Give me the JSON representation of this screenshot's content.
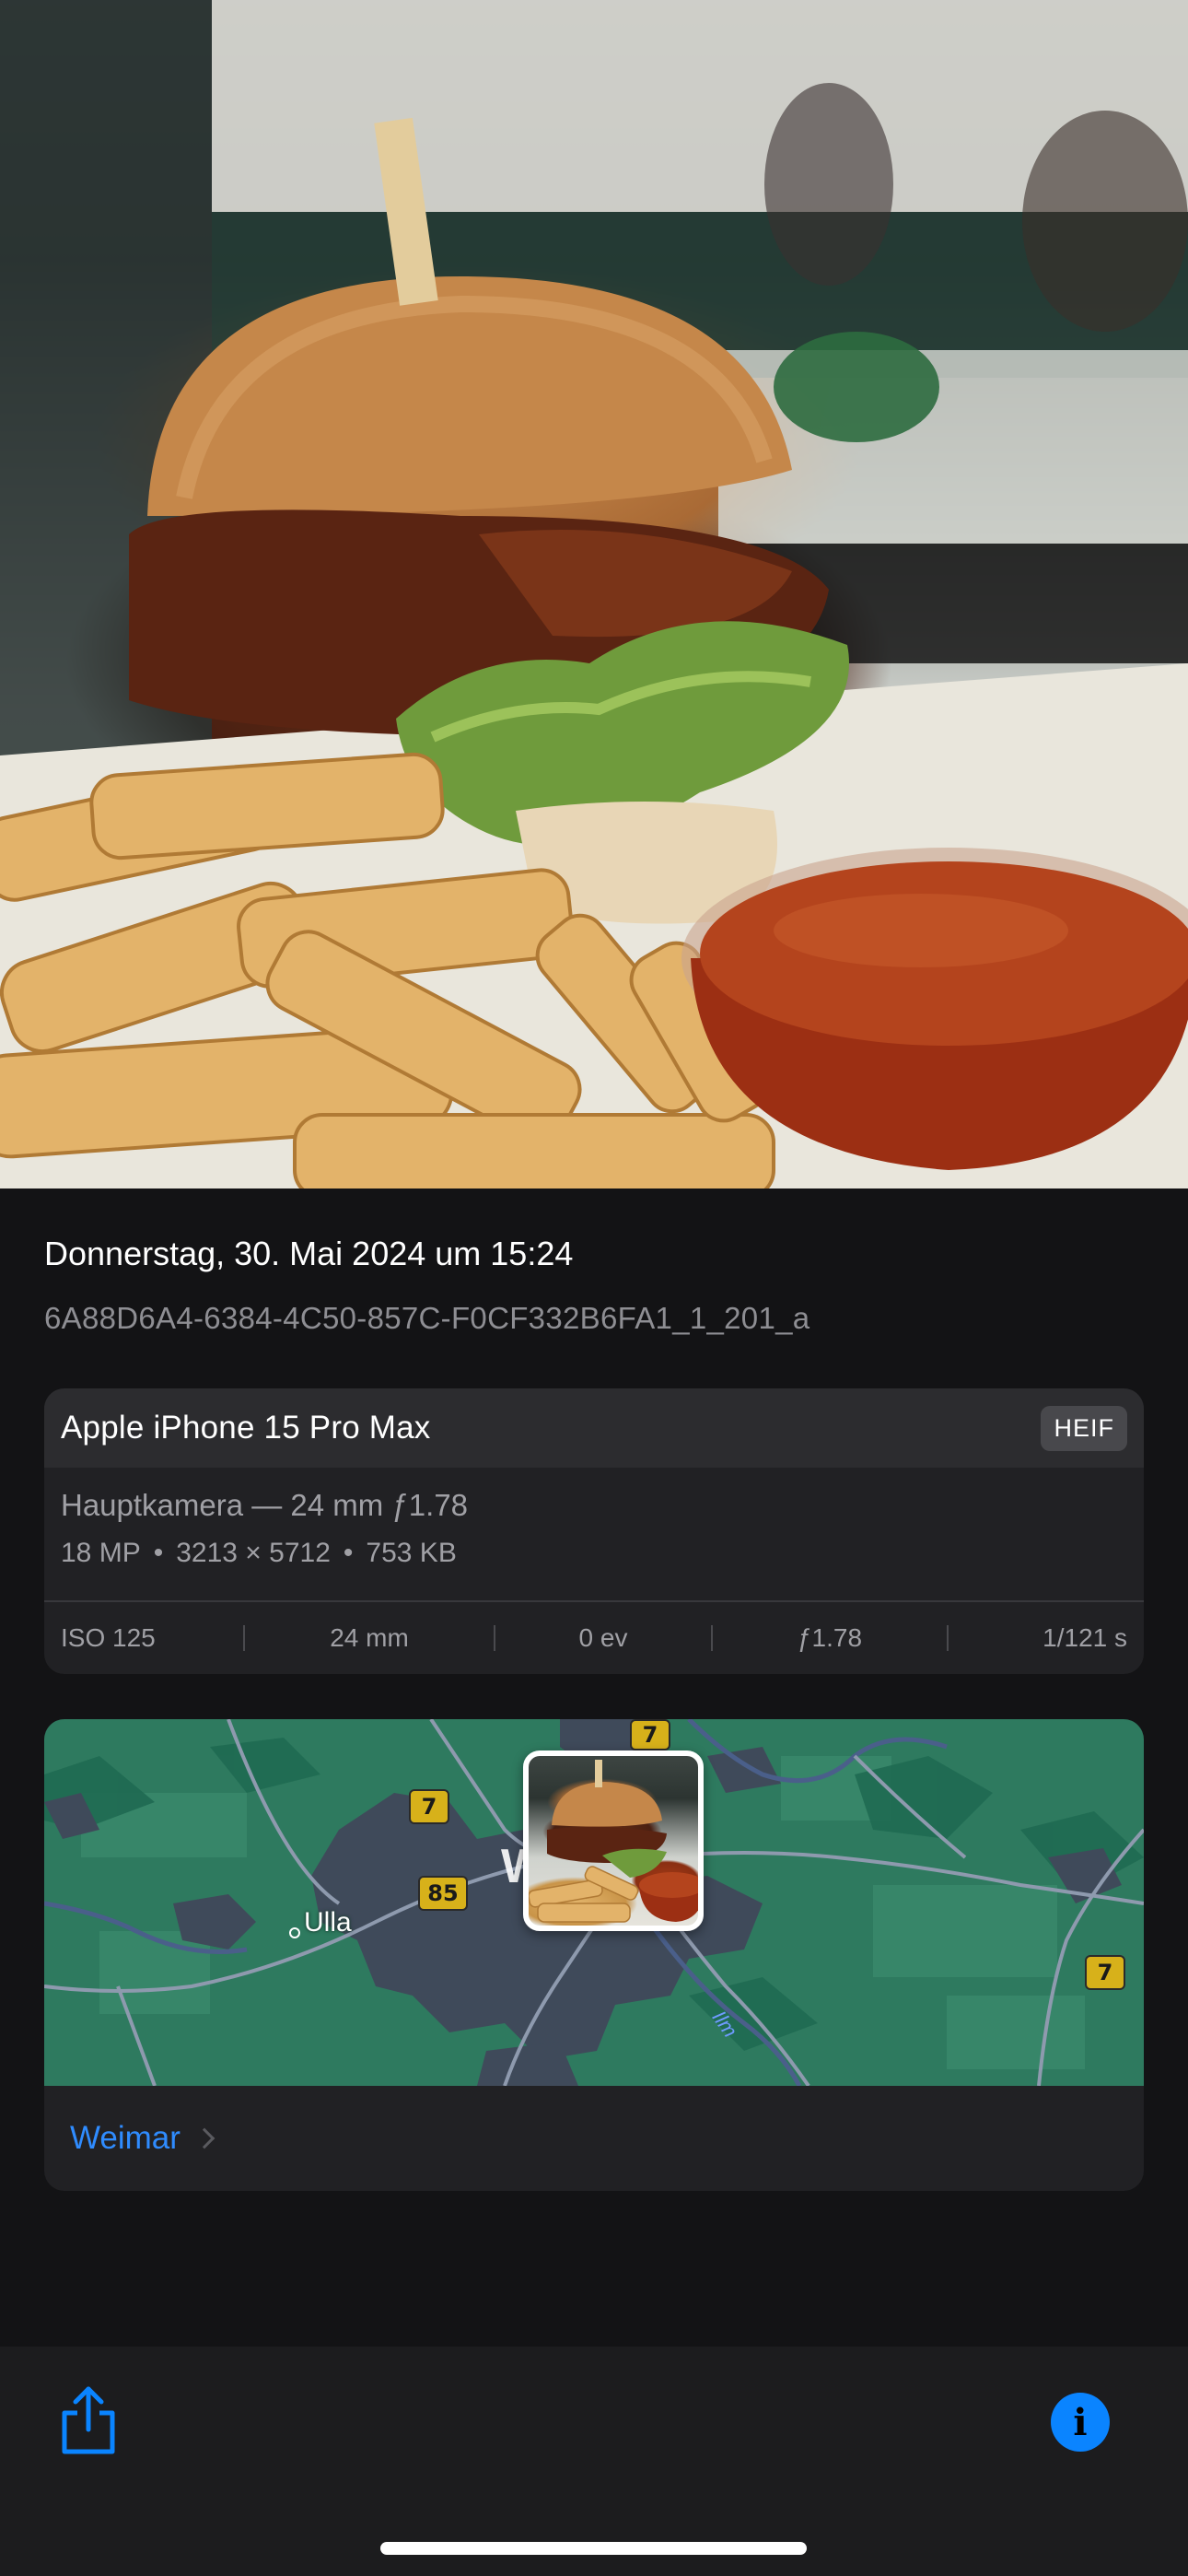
{
  "photo": {
    "description_icon": "photo-burger-fries"
  },
  "info": {
    "date": "Donnerstag, 30. Mai 2024 um 15:24",
    "filename": "6A88D6A4-6384-4C50-857C-F0CF332B6FA1_1_201_a"
  },
  "camera": {
    "model": "Apple iPhone 15 Pro Max",
    "format": "HEIF",
    "lens": "Hauptkamera — 24 mm ƒ1.78",
    "megapixels": "18 MP",
    "resolution": "3213 × 5712",
    "filesize": "753 KB",
    "separator": "•",
    "exif": {
      "iso": "ISO 125",
      "focal": "24 mm",
      "ev": "0 ev",
      "aperture": "ƒ1.78",
      "shutter": "1/121 s"
    }
  },
  "map": {
    "shields": [
      "7",
      "7",
      "85",
      "7"
    ],
    "places": {
      "ulla": "Ulla",
      "city_initial": "W"
    },
    "river": "Ilm",
    "location_name": "Weimar",
    "colors": {
      "land": "#2e7a5f",
      "urban": "#3f4a5a",
      "roads": "#8e9aae"
    }
  },
  "toolbar": {
    "share_icon": "share-icon",
    "info_icon": "info-icon",
    "info_glyph": "i",
    "accent": "#0a84ff"
  }
}
